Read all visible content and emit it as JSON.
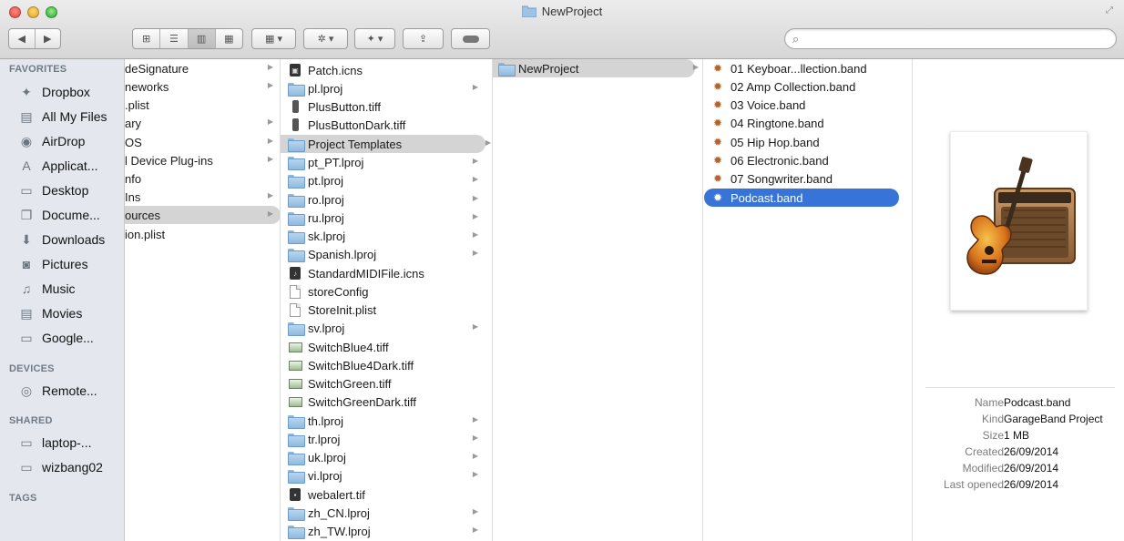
{
  "window": {
    "title": "NewProject"
  },
  "toolbar": {
    "back_icon": "chevron-left",
    "forward_icon": "chevron-right",
    "view_modes": [
      "icon-view",
      "list-view",
      "column-view",
      "coverflow-view"
    ],
    "active_view": "column-view",
    "arrange_icon": "arrange-grid",
    "action_icon": "gear",
    "dropbox_icon": "dropbox",
    "share_icon": "share",
    "tags_icon": "tag",
    "search": {
      "placeholder": "",
      "value": ""
    }
  },
  "sidebar": {
    "favorites_heading": "FAVORITES",
    "favorites": [
      {
        "label": "Dropbox",
        "icon": "dropbox-icon"
      },
      {
        "label": "All My Files",
        "icon": "all-files-icon"
      },
      {
        "label": "AirDrop",
        "icon": "airdrop-icon"
      },
      {
        "label": "Applicat...",
        "icon": "applications-icon"
      },
      {
        "label": "Desktop",
        "icon": "desktop-icon"
      },
      {
        "label": "Docume...",
        "icon": "documents-icon"
      },
      {
        "label": "Downloads",
        "icon": "downloads-icon"
      },
      {
        "label": "Pictures",
        "icon": "pictures-icon"
      },
      {
        "label": "Music",
        "icon": "music-icon"
      },
      {
        "label": "Movies",
        "icon": "movies-icon"
      },
      {
        "label": "Google...",
        "icon": "folder-icon"
      }
    ],
    "devices_heading": "DEVICES",
    "devices": [
      {
        "label": "Remote...",
        "icon": "remote-disc-icon"
      }
    ],
    "shared_heading": "SHARED",
    "shared": [
      {
        "label": "laptop-...",
        "icon": "computer-icon"
      },
      {
        "label": "wizbang02",
        "icon": "computer-icon"
      }
    ],
    "tags_heading": "TAGS"
  },
  "column1": [
    {
      "label": "deSignature",
      "arrow": true
    },
    {
      "label": "neworks",
      "arrow": true
    },
    {
      "label": ".plist",
      "arrow": false
    },
    {
      "label": "ary",
      "arrow": true
    },
    {
      "label": "OS",
      "arrow": true
    },
    {
      "label": "l Device Plug-ins",
      "arrow": true
    },
    {
      "label": "nfo",
      "arrow": false
    },
    {
      "label": "Ins",
      "arrow": true
    },
    {
      "label": "ources",
      "arrow": true,
      "selected": true
    },
    {
      "label": "ion.plist",
      "arrow": false
    }
  ],
  "column2": [
    {
      "label": "Patch.icns",
      "icon": "dark"
    },
    {
      "label": "pl.lproj",
      "icon": "folder",
      "arrow": true
    },
    {
      "label": "PlusButton.tiff",
      "icon": "phone"
    },
    {
      "label": "PlusButtonDark.tiff",
      "icon": "phone"
    },
    {
      "label": "Project Templates",
      "icon": "folder",
      "arrow": true,
      "selected": true
    },
    {
      "label": "pt_PT.lproj",
      "icon": "folder",
      "arrow": true
    },
    {
      "label": "pt.lproj",
      "icon": "folder",
      "arrow": true
    },
    {
      "label": "ro.lproj",
      "icon": "folder",
      "arrow": true
    },
    {
      "label": "ru.lproj",
      "icon": "folder",
      "arrow": true
    },
    {
      "label": "sk.lproj",
      "icon": "folder",
      "arrow": true
    },
    {
      "label": "Spanish.lproj",
      "icon": "folder",
      "arrow": true
    },
    {
      "label": "StandardMIDIFile.icns",
      "icon": "dark"
    },
    {
      "label": "storeConfig",
      "icon": "doc"
    },
    {
      "label": "StoreInit.plist",
      "icon": "doc"
    },
    {
      "label": "sv.lproj",
      "icon": "folder",
      "arrow": true
    },
    {
      "label": "SwitchBlue4.tiff",
      "icon": "image"
    },
    {
      "label": "SwitchBlue4Dark.tiff",
      "icon": "image"
    },
    {
      "label": "SwitchGreen.tiff",
      "icon": "image"
    },
    {
      "label": "SwitchGreenDark.tiff",
      "icon": "image"
    },
    {
      "label": "th.lproj",
      "icon": "folder",
      "arrow": true
    },
    {
      "label": "tr.lproj",
      "icon": "folder",
      "arrow": true
    },
    {
      "label": "uk.lproj",
      "icon": "folder",
      "arrow": true
    },
    {
      "label": "vi.lproj",
      "icon": "folder",
      "arrow": true
    },
    {
      "label": "webalert.tif",
      "icon": "dark"
    },
    {
      "label": "zh_CN.lproj",
      "icon": "folder",
      "arrow": true
    },
    {
      "label": "zh_TW.lproj",
      "icon": "folder",
      "arrow": true
    }
  ],
  "column3": [
    {
      "label": "NewProject",
      "icon": "folder",
      "arrow": true,
      "selected": true
    }
  ],
  "column4": [
    {
      "label": "01 Keyboar...llection.band"
    },
    {
      "label": "02 Amp Collection.band"
    },
    {
      "label": "03 Voice.band"
    },
    {
      "label": "04 Ringtone.band"
    },
    {
      "label": "05 Hip Hop.band"
    },
    {
      "label": "06 Electronic.band"
    },
    {
      "label": "07 Songwriter.band"
    },
    {
      "label": "Podcast.band",
      "selected": true
    }
  ],
  "preview": {
    "icon": "garageband-icon",
    "info": [
      {
        "label": "Name",
        "value": "Podcast.band"
      },
      {
        "label": "Kind",
        "value": "GarageBand Project"
      },
      {
        "label": "Size",
        "value": "1 MB"
      },
      {
        "label": "Created",
        "value": "26/09/2014"
      },
      {
        "label": "Modified",
        "value": "26/09/2014"
      },
      {
        "label": "Last opened",
        "value": "26/09/2014"
      }
    ]
  },
  "colors": {
    "selection_blue": "#3874d8",
    "selection_grey": "#d4d4d4",
    "sidebar_bg": "#e4e8ee"
  }
}
